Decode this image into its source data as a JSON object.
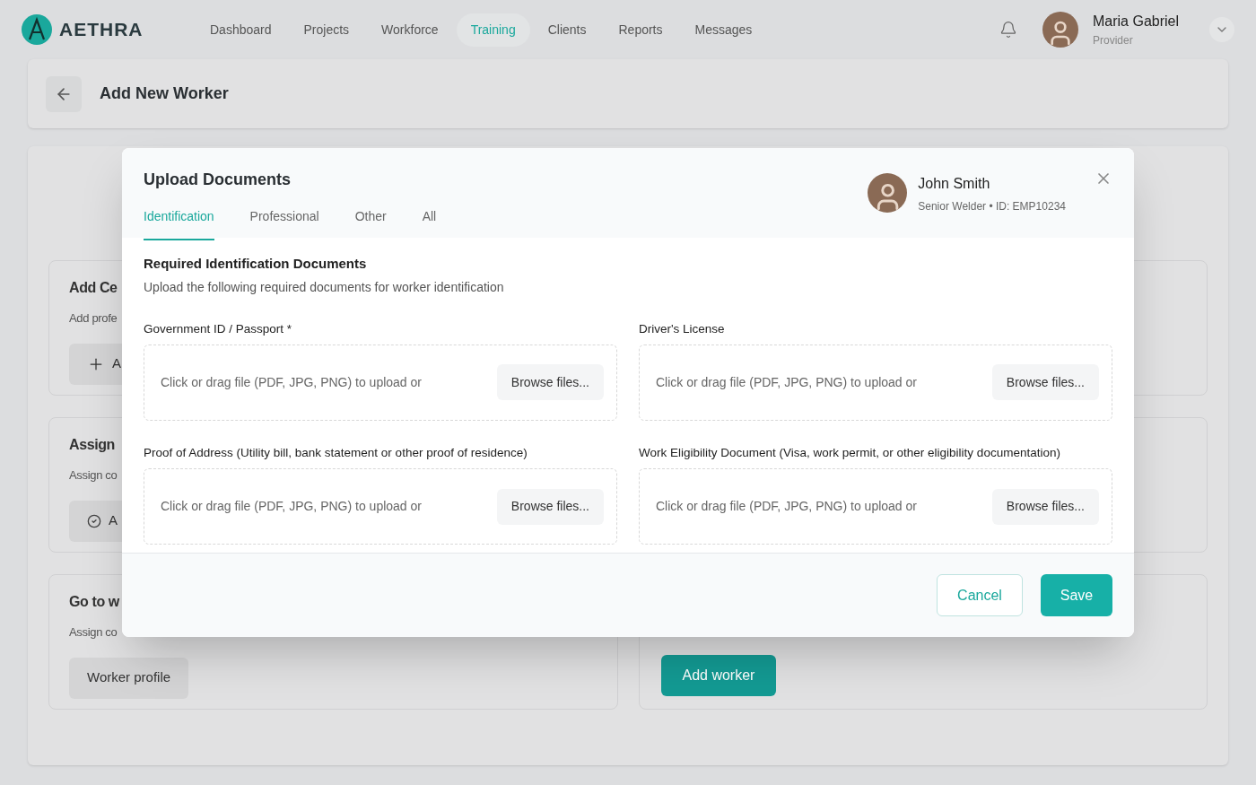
{
  "nav": {
    "logo": "AETHRA",
    "items": [
      {
        "label": "Dashboard",
        "selected": false
      },
      {
        "label": "Projects",
        "selected": false
      },
      {
        "label": "Workforce",
        "selected": false
      },
      {
        "label": "Training",
        "selected": true
      },
      {
        "label": "Clients",
        "selected": false
      },
      {
        "label": "Reports",
        "selected": false
      },
      {
        "label": "Messages",
        "selected": false
      }
    ],
    "user": {
      "name": "Maria Gabriel",
      "role": "Provider"
    }
  },
  "page": {
    "title": "Add New Worker"
  },
  "left_cards": [
    {
      "title": "Add Ce",
      "description": "Add profe",
      "button": {
        "kind": "add",
        "label": "A"
      }
    },
    {
      "title": "Assign",
      "description": "Assign co",
      "button": {
        "kind": "check",
        "label": "A"
      }
    },
    {
      "title": "Go to w",
      "description": "Assign co",
      "button": {
        "kind": "plain",
        "label": "Worker profile"
      }
    }
  ],
  "right_card": {
    "button": {
      "label": "Add worker"
    }
  },
  "modal": {
    "title": "Upload Documents",
    "tabs": [
      {
        "label": "Identification",
        "selected": true
      },
      {
        "label": "Professional",
        "selected": false
      },
      {
        "label": "Other",
        "selected": false
      },
      {
        "label": "All",
        "selected": false
      }
    ],
    "worker": {
      "name": "John Smith",
      "detail": "Senior Welder • ID: EMP10234"
    },
    "section": {
      "title": "Required Identification Documents",
      "subtitle": "Upload the following required documents for worker identification"
    },
    "fields": [
      {
        "label": "Government ID / Passport *",
        "hint": "Click or drag file (PDF, JPG, PNG) to upload or",
        "button": "Browse files..."
      },
      {
        "label": "Driver's License",
        "hint": "Click or drag file (PDF, JPG, PNG) to upload or",
        "button": "Browse files..."
      },
      {
        "label": "Proof of Address (Utility bill, bank statement or other proof of residence)",
        "hint": "Click or drag file (PDF, JPG, PNG) to upload or",
        "button": "Browse files..."
      },
      {
        "label": "Work Eligibility Document (Visa, work permit, or other eligibility documentation)",
        "hint": "Click or drag file (PDF, JPG, PNG) to upload or",
        "button": "Browse files..."
      }
    ],
    "cancel": "Cancel",
    "save": "Save"
  }
}
